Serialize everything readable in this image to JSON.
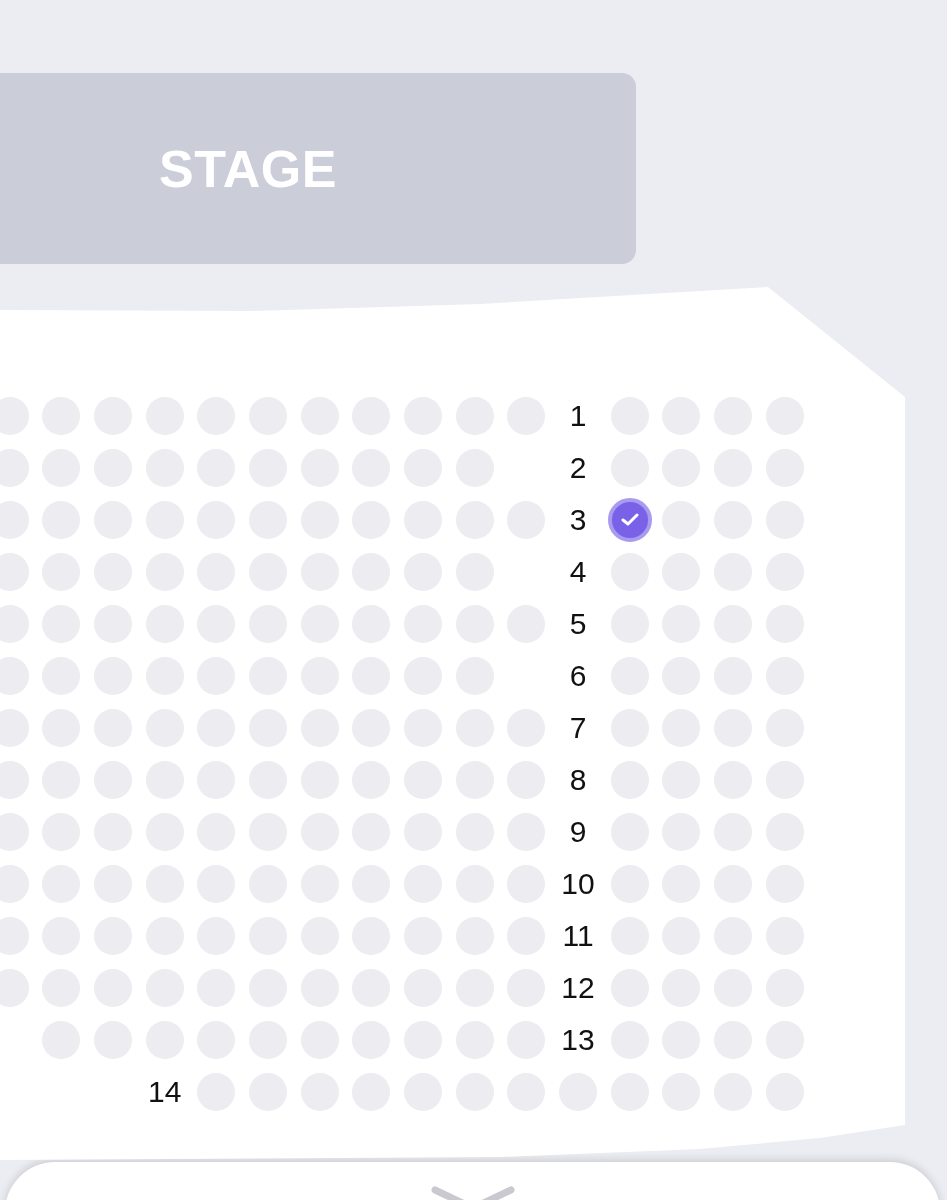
{
  "stage": {
    "label": "STAGE"
  },
  "rows": [
    {
      "cells": [
        {
          "kind": "seat",
          "selected": false
        },
        {
          "kind": "seat",
          "selected": false
        },
        {
          "kind": "seat",
          "selected": false
        },
        {
          "kind": "seat",
          "selected": false
        },
        {
          "kind": "seat",
          "selected": false
        },
        {
          "kind": "seat",
          "selected": false
        },
        {
          "kind": "seat",
          "selected": false
        },
        {
          "kind": "seat",
          "selected": false
        },
        {
          "kind": "seat",
          "selected": false
        },
        {
          "kind": "seat",
          "selected": false
        },
        {
          "kind": "seat",
          "selected": false
        },
        {
          "kind": "label",
          "text": "1"
        },
        {
          "kind": "seat",
          "selected": false
        },
        {
          "kind": "seat",
          "selected": false
        },
        {
          "kind": "seat",
          "selected": false
        },
        {
          "kind": "seat",
          "selected": false
        }
      ]
    },
    {
      "cells": [
        {
          "kind": "seat",
          "selected": false
        },
        {
          "kind": "seat",
          "selected": false
        },
        {
          "kind": "seat",
          "selected": false
        },
        {
          "kind": "seat",
          "selected": false
        },
        {
          "kind": "seat",
          "selected": false
        },
        {
          "kind": "seat",
          "selected": false
        },
        {
          "kind": "seat",
          "selected": false
        },
        {
          "kind": "seat",
          "selected": false
        },
        {
          "kind": "seat",
          "selected": false
        },
        {
          "kind": "seat",
          "selected": false
        },
        {
          "kind": "gap"
        },
        {
          "kind": "label",
          "text": "2"
        },
        {
          "kind": "seat",
          "selected": false
        },
        {
          "kind": "seat",
          "selected": false
        },
        {
          "kind": "seat",
          "selected": false
        },
        {
          "kind": "seat",
          "selected": false
        }
      ]
    },
    {
      "cells": [
        {
          "kind": "seat",
          "selected": false
        },
        {
          "kind": "seat",
          "selected": false
        },
        {
          "kind": "seat",
          "selected": false
        },
        {
          "kind": "seat",
          "selected": false
        },
        {
          "kind": "seat",
          "selected": false
        },
        {
          "kind": "seat",
          "selected": false
        },
        {
          "kind": "seat",
          "selected": false
        },
        {
          "kind": "seat",
          "selected": false
        },
        {
          "kind": "seat",
          "selected": false
        },
        {
          "kind": "seat",
          "selected": false
        },
        {
          "kind": "seat",
          "selected": false
        },
        {
          "kind": "label",
          "text": "3"
        },
        {
          "kind": "seat",
          "selected": true
        },
        {
          "kind": "seat",
          "selected": false
        },
        {
          "kind": "seat",
          "selected": false
        },
        {
          "kind": "seat",
          "selected": false
        }
      ]
    },
    {
      "cells": [
        {
          "kind": "seat",
          "selected": false
        },
        {
          "kind": "seat",
          "selected": false
        },
        {
          "kind": "seat",
          "selected": false
        },
        {
          "kind": "seat",
          "selected": false
        },
        {
          "kind": "seat",
          "selected": false
        },
        {
          "kind": "seat",
          "selected": false
        },
        {
          "kind": "seat",
          "selected": false
        },
        {
          "kind": "seat",
          "selected": false
        },
        {
          "kind": "seat",
          "selected": false
        },
        {
          "kind": "seat",
          "selected": false
        },
        {
          "kind": "gap"
        },
        {
          "kind": "label",
          "text": "4"
        },
        {
          "kind": "seat",
          "selected": false
        },
        {
          "kind": "seat",
          "selected": false
        },
        {
          "kind": "seat",
          "selected": false
        },
        {
          "kind": "seat",
          "selected": false
        }
      ]
    },
    {
      "cells": [
        {
          "kind": "seat",
          "selected": false
        },
        {
          "kind": "seat",
          "selected": false
        },
        {
          "kind": "seat",
          "selected": false
        },
        {
          "kind": "seat",
          "selected": false
        },
        {
          "kind": "seat",
          "selected": false
        },
        {
          "kind": "seat",
          "selected": false
        },
        {
          "kind": "seat",
          "selected": false
        },
        {
          "kind": "seat",
          "selected": false
        },
        {
          "kind": "seat",
          "selected": false
        },
        {
          "kind": "seat",
          "selected": false
        },
        {
          "kind": "seat",
          "selected": false
        },
        {
          "kind": "label",
          "text": "5"
        },
        {
          "kind": "seat",
          "selected": false
        },
        {
          "kind": "seat",
          "selected": false
        },
        {
          "kind": "seat",
          "selected": false
        },
        {
          "kind": "seat",
          "selected": false
        }
      ]
    },
    {
      "cells": [
        {
          "kind": "seat",
          "selected": false
        },
        {
          "kind": "seat",
          "selected": false
        },
        {
          "kind": "seat",
          "selected": false
        },
        {
          "kind": "seat",
          "selected": false
        },
        {
          "kind": "seat",
          "selected": false
        },
        {
          "kind": "seat",
          "selected": false
        },
        {
          "kind": "seat",
          "selected": false
        },
        {
          "kind": "seat",
          "selected": false
        },
        {
          "kind": "seat",
          "selected": false
        },
        {
          "kind": "seat",
          "selected": false
        },
        {
          "kind": "gap"
        },
        {
          "kind": "label",
          "text": "6"
        },
        {
          "kind": "seat",
          "selected": false
        },
        {
          "kind": "seat",
          "selected": false
        },
        {
          "kind": "seat",
          "selected": false
        },
        {
          "kind": "seat",
          "selected": false
        }
      ]
    },
    {
      "cells": [
        {
          "kind": "seat",
          "selected": false
        },
        {
          "kind": "seat",
          "selected": false
        },
        {
          "kind": "seat",
          "selected": false
        },
        {
          "kind": "seat",
          "selected": false
        },
        {
          "kind": "seat",
          "selected": false
        },
        {
          "kind": "seat",
          "selected": false
        },
        {
          "kind": "seat",
          "selected": false
        },
        {
          "kind": "seat",
          "selected": false
        },
        {
          "kind": "seat",
          "selected": false
        },
        {
          "kind": "seat",
          "selected": false
        },
        {
          "kind": "seat",
          "selected": false
        },
        {
          "kind": "label",
          "text": "7"
        },
        {
          "kind": "seat",
          "selected": false
        },
        {
          "kind": "seat",
          "selected": false
        },
        {
          "kind": "seat",
          "selected": false
        },
        {
          "kind": "seat",
          "selected": false
        }
      ]
    },
    {
      "cells": [
        {
          "kind": "seat",
          "selected": false
        },
        {
          "kind": "seat",
          "selected": false
        },
        {
          "kind": "seat",
          "selected": false
        },
        {
          "kind": "seat",
          "selected": false
        },
        {
          "kind": "seat",
          "selected": false
        },
        {
          "kind": "seat",
          "selected": false
        },
        {
          "kind": "seat",
          "selected": false
        },
        {
          "kind": "seat",
          "selected": false
        },
        {
          "kind": "seat",
          "selected": false
        },
        {
          "kind": "seat",
          "selected": false
        },
        {
          "kind": "seat",
          "selected": false
        },
        {
          "kind": "label",
          "text": "8"
        },
        {
          "kind": "seat",
          "selected": false
        },
        {
          "kind": "seat",
          "selected": false
        },
        {
          "kind": "seat",
          "selected": false
        },
        {
          "kind": "seat",
          "selected": false
        }
      ]
    },
    {
      "cells": [
        {
          "kind": "seat",
          "selected": false
        },
        {
          "kind": "seat",
          "selected": false
        },
        {
          "kind": "seat",
          "selected": false
        },
        {
          "kind": "seat",
          "selected": false
        },
        {
          "kind": "seat",
          "selected": false
        },
        {
          "kind": "seat",
          "selected": false
        },
        {
          "kind": "seat",
          "selected": false
        },
        {
          "kind": "seat",
          "selected": false
        },
        {
          "kind": "seat",
          "selected": false
        },
        {
          "kind": "seat",
          "selected": false
        },
        {
          "kind": "seat",
          "selected": false
        },
        {
          "kind": "label",
          "text": "9"
        },
        {
          "kind": "seat",
          "selected": false
        },
        {
          "kind": "seat",
          "selected": false
        },
        {
          "kind": "seat",
          "selected": false
        },
        {
          "kind": "seat",
          "selected": false
        }
      ]
    },
    {
      "cells": [
        {
          "kind": "seat",
          "selected": false
        },
        {
          "kind": "seat",
          "selected": false
        },
        {
          "kind": "seat",
          "selected": false
        },
        {
          "kind": "seat",
          "selected": false
        },
        {
          "kind": "seat",
          "selected": false
        },
        {
          "kind": "seat",
          "selected": false
        },
        {
          "kind": "seat",
          "selected": false
        },
        {
          "kind": "seat",
          "selected": false
        },
        {
          "kind": "seat",
          "selected": false
        },
        {
          "kind": "seat",
          "selected": false
        },
        {
          "kind": "seat",
          "selected": false
        },
        {
          "kind": "label",
          "text": "10"
        },
        {
          "kind": "seat",
          "selected": false
        },
        {
          "kind": "seat",
          "selected": false
        },
        {
          "kind": "seat",
          "selected": false
        },
        {
          "kind": "seat",
          "selected": false
        }
      ]
    },
    {
      "cells": [
        {
          "kind": "seat",
          "selected": false
        },
        {
          "kind": "seat",
          "selected": false
        },
        {
          "kind": "seat",
          "selected": false
        },
        {
          "kind": "seat",
          "selected": false
        },
        {
          "kind": "seat",
          "selected": false
        },
        {
          "kind": "seat",
          "selected": false
        },
        {
          "kind": "seat",
          "selected": false
        },
        {
          "kind": "seat",
          "selected": false
        },
        {
          "kind": "seat",
          "selected": false
        },
        {
          "kind": "seat",
          "selected": false
        },
        {
          "kind": "seat",
          "selected": false
        },
        {
          "kind": "label",
          "text": "11"
        },
        {
          "kind": "seat",
          "selected": false
        },
        {
          "kind": "seat",
          "selected": false
        },
        {
          "kind": "seat",
          "selected": false
        },
        {
          "kind": "seat",
          "selected": false
        }
      ]
    },
    {
      "cells": [
        {
          "kind": "seat",
          "selected": false
        },
        {
          "kind": "seat",
          "selected": false
        },
        {
          "kind": "seat",
          "selected": false
        },
        {
          "kind": "seat",
          "selected": false
        },
        {
          "kind": "seat",
          "selected": false
        },
        {
          "kind": "seat",
          "selected": false
        },
        {
          "kind": "seat",
          "selected": false
        },
        {
          "kind": "seat",
          "selected": false
        },
        {
          "kind": "seat",
          "selected": false
        },
        {
          "kind": "seat",
          "selected": false
        },
        {
          "kind": "seat",
          "selected": false
        },
        {
          "kind": "label",
          "text": "12"
        },
        {
          "kind": "seat",
          "selected": false
        },
        {
          "kind": "seat",
          "selected": false
        },
        {
          "kind": "seat",
          "selected": false
        },
        {
          "kind": "seat",
          "selected": false
        }
      ]
    },
    {
      "cells": [
        {
          "kind": "gap"
        },
        {
          "kind": "seat",
          "selected": false
        },
        {
          "kind": "seat",
          "selected": false
        },
        {
          "kind": "seat",
          "selected": false
        },
        {
          "kind": "seat",
          "selected": false
        },
        {
          "kind": "seat",
          "selected": false
        },
        {
          "kind": "seat",
          "selected": false
        },
        {
          "kind": "seat",
          "selected": false
        },
        {
          "kind": "seat",
          "selected": false
        },
        {
          "kind": "seat",
          "selected": false
        },
        {
          "kind": "seat",
          "selected": false
        },
        {
          "kind": "label",
          "text": "13"
        },
        {
          "kind": "seat",
          "selected": false
        },
        {
          "kind": "seat",
          "selected": false
        },
        {
          "kind": "seat",
          "selected": false
        },
        {
          "kind": "seat",
          "selected": false
        }
      ]
    },
    {
      "cells": [
        {
          "kind": "gap"
        },
        {
          "kind": "gap"
        },
        {
          "kind": "gap"
        },
        {
          "kind": "label",
          "text": "14"
        },
        {
          "kind": "seat",
          "selected": false
        },
        {
          "kind": "seat",
          "selected": false
        },
        {
          "kind": "seat",
          "selected": false
        },
        {
          "kind": "seat",
          "selected": false
        },
        {
          "kind": "seat",
          "selected": false
        },
        {
          "kind": "seat",
          "selected": false
        },
        {
          "kind": "seat",
          "selected": false
        },
        {
          "kind": "seat",
          "selected": false
        },
        {
          "kind": "seat",
          "selected": false
        },
        {
          "kind": "seat",
          "selected": false
        },
        {
          "kind": "seat",
          "selected": false
        },
        {
          "kind": "seat",
          "selected": false
        }
      ]
    }
  ]
}
